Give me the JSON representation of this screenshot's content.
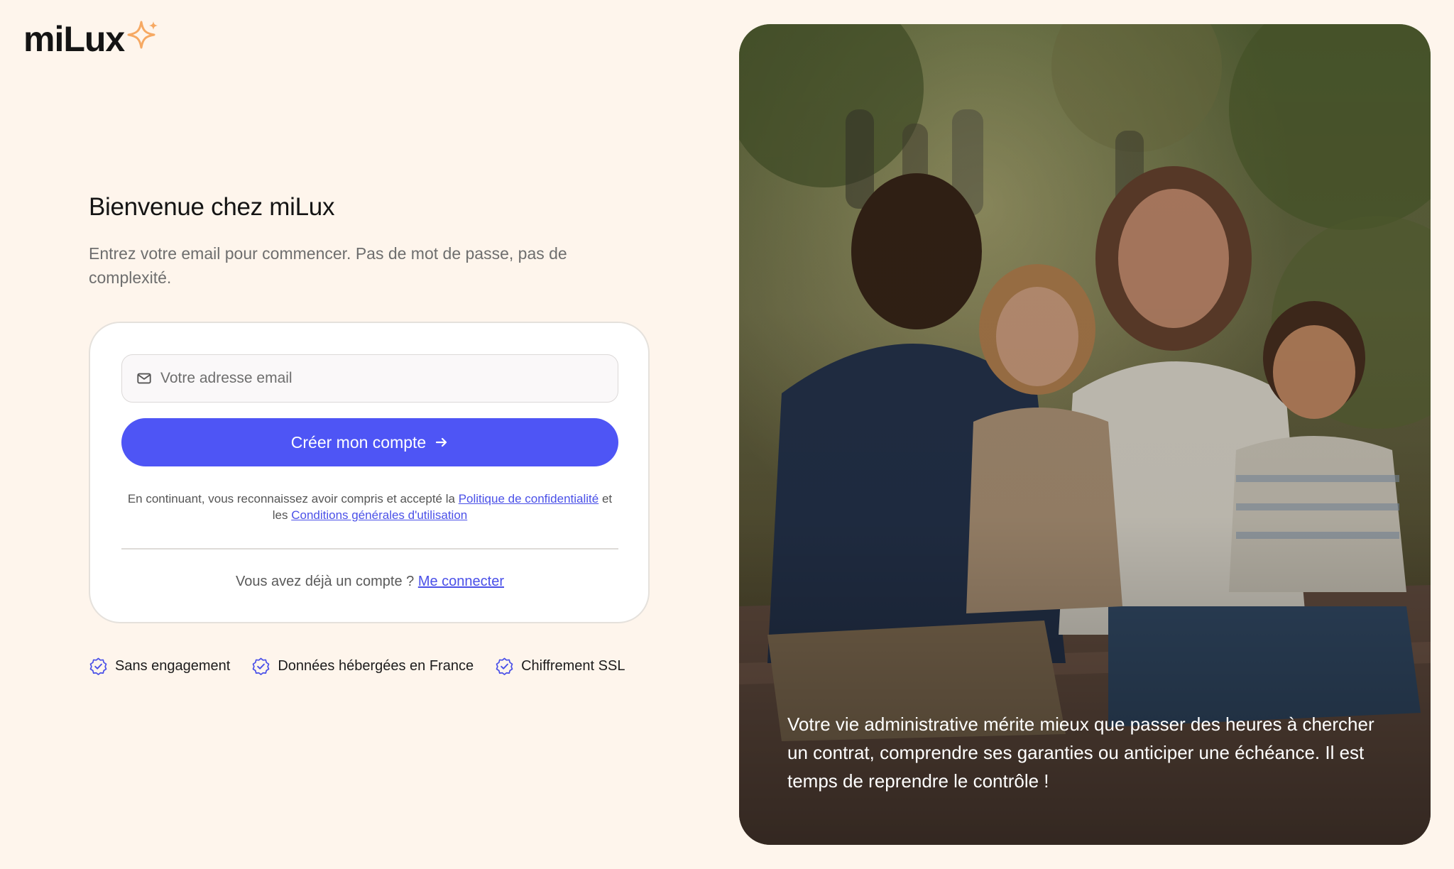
{
  "brand": {
    "name": "miLux"
  },
  "welcome": {
    "title": "Bienvenue chez miLux",
    "subtitle": "Entrez votre email pour commencer. Pas de mot de passe, pas de complexité."
  },
  "form": {
    "email_placeholder": "Votre adresse email",
    "submit_label": "Créer mon compte",
    "legal_prefix": "En continuant, vous reconnaissez avoir compris et accepté la",
    "privacy_link": "Politique de confidentialité",
    "legal_middle": "et les",
    "terms_link": "Conditions générales d'utilisation",
    "login_prompt": "Vous avez déjà un compte ?",
    "login_link": "Me connecter"
  },
  "badges": [
    {
      "label": "Sans engagement",
      "icon": "verified-badge-icon"
    },
    {
      "label": "Données hébergées en France",
      "icon": "verified-badge-icon"
    },
    {
      "label": "Chiffrement SSL",
      "icon": "verified-badge-icon"
    }
  ],
  "hero": {
    "caption": "Votre vie administrative mérite mieux que passer des heures à chercher un contrat, comprendre ses garanties ou anticiper une échéance. Il est temps de reprendre le contrôle !"
  },
  "colors": {
    "background": "#fef5ec",
    "accent": "#4e55f5",
    "link": "#4a50e8",
    "logo_star": "#f6a963",
    "badge_icon": "#4a50e8"
  }
}
